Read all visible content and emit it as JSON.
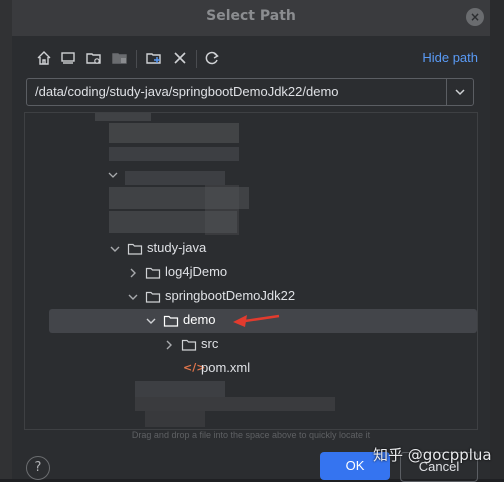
{
  "dialog": {
    "title": "Select Path",
    "hide_path_label": "Hide path",
    "path_value": "/data/coding/study-java/springbootDemoJdk22/demo",
    "drag_hint": "Drag and drop a file into the space above to quickly locate it",
    "help_label": "?",
    "ok_label": "OK",
    "cancel_label": "Cancel"
  },
  "toolbar": {
    "icons": [
      "home-icon",
      "desktop-icon",
      "project-folder-icon",
      "module-folder-icon",
      "new-folder-icon",
      "delete-icon",
      "refresh-icon"
    ]
  },
  "tree": {
    "items": [
      {
        "label": "study-java",
        "type": "folder",
        "expanded": true
      },
      {
        "label": "log4jDemo",
        "type": "folder",
        "expanded": false
      },
      {
        "label": "springbootDemoJdk22",
        "type": "folder",
        "expanded": true
      },
      {
        "label": "demo",
        "type": "folder",
        "expanded": true,
        "selected": true
      },
      {
        "label": "src",
        "type": "folder",
        "expanded": false
      },
      {
        "label": "pom.xml",
        "type": "file",
        "icon": "xml-file-icon"
      }
    ]
  },
  "watermark": "知乎 @gocpplua",
  "colors": {
    "accent": "#3574f0",
    "link": "#5a9bf6",
    "arrow": "#e23b2e"
  }
}
